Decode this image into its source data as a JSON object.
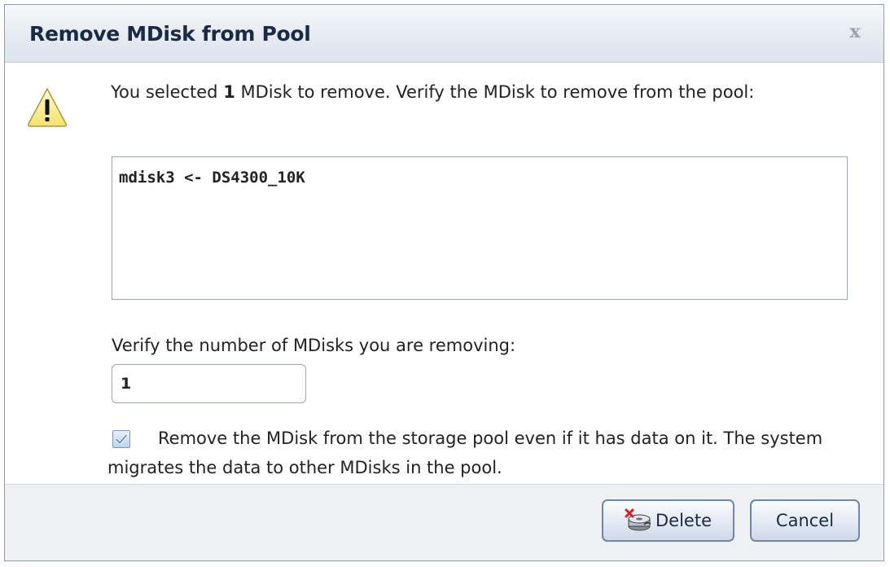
{
  "dialog": {
    "title": "Remove MDisk from Pool",
    "close_label": "x"
  },
  "message": {
    "prefix": "You selected ",
    "count": "1",
    "suffix": " MDisk to remove. Verify the MDisk to remove from the pool:"
  },
  "mdisk_list": {
    "items": [
      "mdisk3 <- DS4300_10K"
    ]
  },
  "verify": {
    "label": "Verify the number of MDisks you are removing:",
    "value": "1"
  },
  "force_remove": {
    "checked": true,
    "label": "Remove the MDisk from the storage pool even if it has data on it. The system migrates the data to other MDisks in the pool."
  },
  "buttons": {
    "delete_label": "Delete",
    "cancel_label": "Cancel"
  },
  "icons": {
    "warning": "warning-icon",
    "delete": "delete-disk-icon",
    "checkbox": "check-icon"
  },
  "colors": {
    "accent": "#6f88a9",
    "warning_fill": "#fdf4a8"
  }
}
